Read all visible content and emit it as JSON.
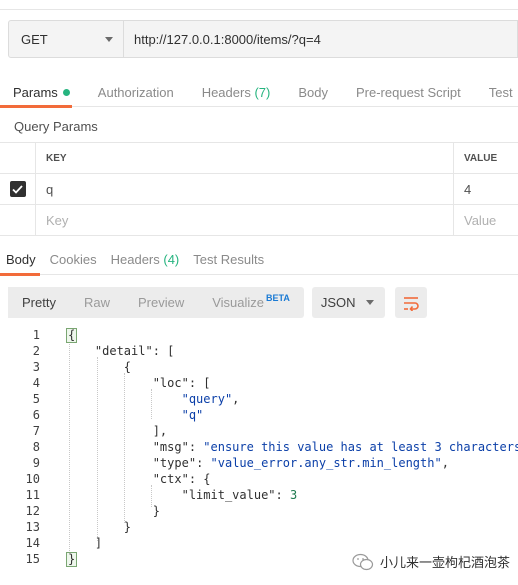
{
  "request": {
    "method": "GET",
    "url": "http://127.0.0.1:8000/items/?q=4"
  },
  "request_tabs": [
    {
      "label": "Params",
      "active": true
    },
    {
      "label": "Authorization"
    },
    {
      "label": "Headers",
      "count": "(7)"
    },
    {
      "label": "Body"
    },
    {
      "label": "Pre-request Script"
    },
    {
      "label": "Test"
    }
  ],
  "query_params": {
    "title": "Query Params",
    "key_header": "KEY",
    "value_header": "VALUE",
    "rows": [
      {
        "key": "q",
        "value": "4",
        "checked": true
      }
    ],
    "key_placeholder": "Key",
    "value_placeholder": "Value"
  },
  "response_tabs": [
    {
      "label": "Body",
      "active": true
    },
    {
      "label": "Cookies"
    },
    {
      "label": "Headers",
      "count": "(4)"
    },
    {
      "label": "Test Results"
    }
  ],
  "toolbar": {
    "views": [
      "Pretty",
      "Raw",
      "Preview",
      "Visualize"
    ],
    "beta": "BETA",
    "format": "JSON",
    "wrap_icon": "wrap-lines-icon"
  },
  "code_lines": [
    "{",
    "    \"detail\": [",
    "        {",
    "            \"loc\": [",
    "                \"query\",",
    "                \"q\"",
    "            ],",
    "            \"msg\": \"ensure this value has at least 3 characters\",",
    "            \"type\": \"value_error.any_str.min_length\",",
    "            \"ctx\": {",
    "                \"limit_value\": 3",
    "            }",
    "        }",
    "    ]",
    "}"
  ],
  "line_numbers": [
    "1",
    "2",
    "3",
    "4",
    "5",
    "6",
    "7",
    "8",
    "9",
    "10",
    "11",
    "12",
    "13",
    "14",
    "15"
  ],
  "watermark": "小儿来一壶枸杞酒泡茶",
  "colors": {
    "accent": "#f26b3a",
    "green": "#26b47f",
    "string": "#0b3fa8",
    "number": "#1f7a4f",
    "beta": "#1a7ad4"
  }
}
